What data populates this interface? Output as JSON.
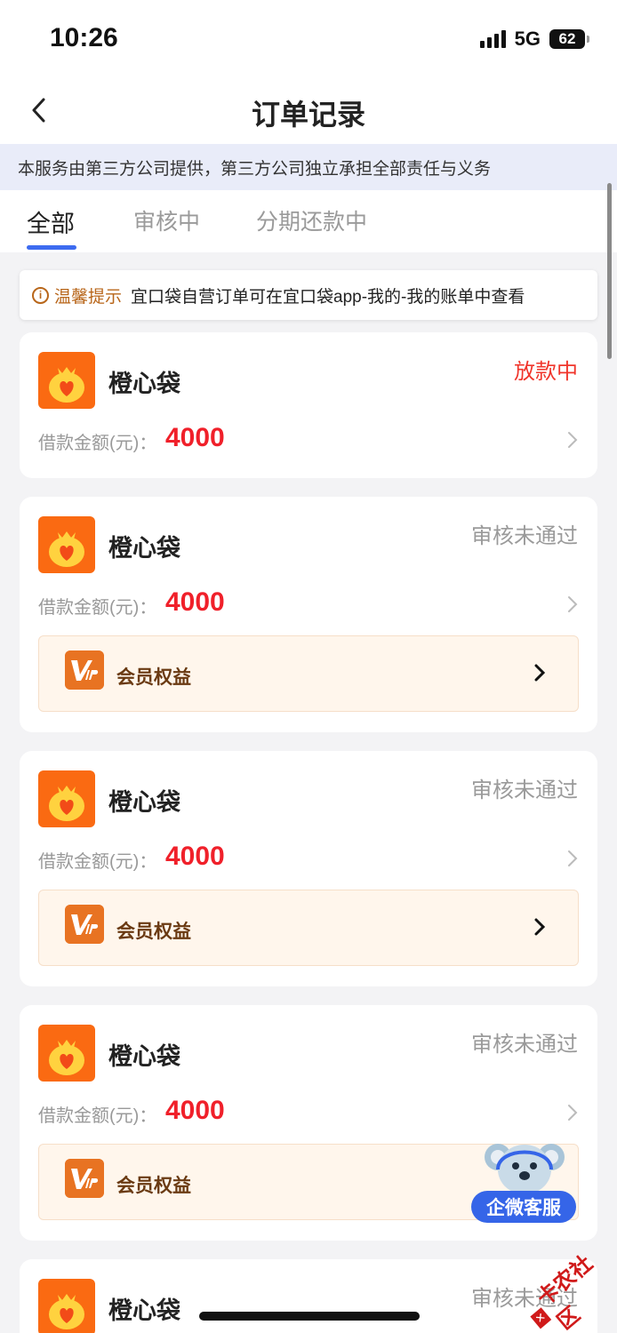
{
  "status_bar": {
    "time": "10:26",
    "network": "5G",
    "battery": "62"
  },
  "nav": {
    "title": "订单记录"
  },
  "notice": "本服务由第三方公司提供，第三方公司独立承担全部责任与义务",
  "tabs": [
    {
      "label": "全部",
      "active": true
    },
    {
      "label": "审核中",
      "active": false
    },
    {
      "label": "分期还款中",
      "active": false
    }
  ],
  "tip": {
    "label": "温馨提示",
    "text": "宜口袋自营订单可在宜口袋app-我的-我的账单中查看"
  },
  "orders": [
    {
      "name": "橙心袋",
      "status": "放款中",
      "amount_label": "借款金额(元)：",
      "amount": "4000"
    },
    {
      "name": "橙心袋",
      "status": "审核未通过",
      "amount_label": "借款金额(元)：",
      "amount": "4000",
      "vip_label": "会员权益"
    },
    {
      "name": "橙心袋",
      "status": "审核未通过",
      "amount_label": "借款金额(元)：",
      "amount": "4000",
      "vip_label": "会员权益"
    },
    {
      "name": "橙心袋",
      "status": "审核未通过",
      "amount_label": "借款金额(元)：",
      "amount": "4000",
      "vip_label": "会员权益"
    },
    {
      "name": "橙心袋",
      "status": "审核未通过"
    }
  ],
  "customer_service": {
    "label": "企微客服"
  },
  "watermark": "卡农社区",
  "colors": {
    "accent": "#3d6bf0",
    "brand_orange": "#fa6a12",
    "amount_red": "#f0202a",
    "status_red": "#f0352b"
  }
}
